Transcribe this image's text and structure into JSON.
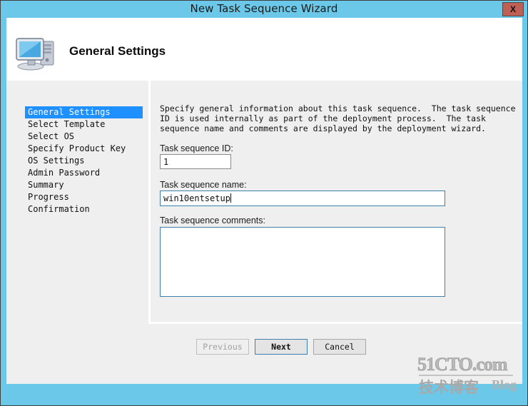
{
  "window": {
    "title": "New Task Sequence Wizard",
    "close_label": "X",
    "accent_color": "#6bc8e8",
    "close_button_color": "#c05f54"
  },
  "header": {
    "title": "General Settings",
    "icon": "computer-monitor-icon"
  },
  "sidebar": {
    "items": [
      {
        "label": "General Settings",
        "active": true
      },
      {
        "label": "Select Template",
        "active": false
      },
      {
        "label": "Select OS",
        "active": false
      },
      {
        "label": "Specify Product Key",
        "active": false
      },
      {
        "label": "OS Settings",
        "active": false
      },
      {
        "label": "Admin Password",
        "active": false
      },
      {
        "label": "Summary",
        "active": false
      },
      {
        "label": "Progress",
        "active": false
      },
      {
        "label": "Confirmation",
        "active": false
      }
    ],
    "highlight_color": "#1e90ff"
  },
  "content": {
    "description": "Specify general information about this task sequence.  The task sequence ID is used internally as part of the deployment process.  The task sequence name and comments are displayed by the deployment wizard.",
    "fields": {
      "id_label": "Task sequence ID:",
      "id_value": "1",
      "name_label": "Task sequence name:",
      "name_value": "win10entsetup",
      "comments_label": "Task sequence comments:",
      "comments_value": ""
    }
  },
  "footer": {
    "previous_label": "Previous",
    "next_label": "Next",
    "cancel_label": "Cancel",
    "previous_enabled": false
  },
  "watermark": {
    "top": "51CTO.com",
    "chinese": "技术博客",
    "blog": "Blog"
  }
}
